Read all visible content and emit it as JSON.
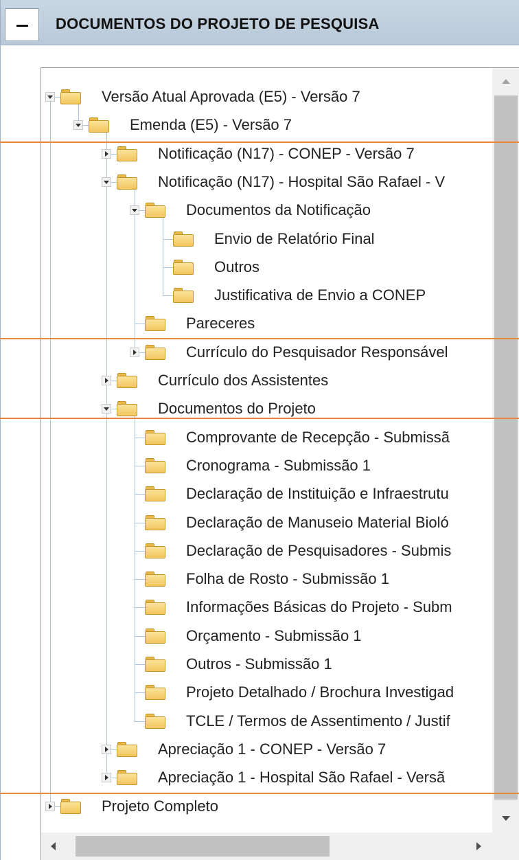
{
  "panel": {
    "title": "DOCUMENTOS DO PROJETO DE PESQUISA",
    "collapse_glyph": "−"
  },
  "tree": [
    {
      "label": "Versão Atual Aprovada (E5) - Versão 7",
      "level": 0,
      "expander": "expanded"
    },
    {
      "label": "Emenda (E5) - Versão 7",
      "level": 1,
      "expander": "expanded"
    },
    {
      "label": "Notificação (N17) - CONEP - Versão 7",
      "level": 2,
      "expander": "collapsed"
    },
    {
      "label": "Notificação (N17) - Hospital São Rafael - V",
      "level": 2,
      "expander": "expanded"
    },
    {
      "label": "Documentos da Notificação",
      "level": 3,
      "expander": "expanded"
    },
    {
      "label": "Envio de Relatório Final",
      "level": 4,
      "expander": "none"
    },
    {
      "label": "Outros",
      "level": 4,
      "expander": "none"
    },
    {
      "label": "Justificativa de Envio a CONEP",
      "level": 4,
      "expander": "none"
    },
    {
      "label": "Pareceres",
      "level": 3,
      "expander": "none"
    },
    {
      "label": "Currículo do Pesquisador Responsável",
      "level": 3,
      "expander": "collapsed"
    },
    {
      "label": "Currículo dos Assistentes",
      "level": 2,
      "expander": "collapsed"
    },
    {
      "label": "Documentos do Projeto",
      "level": 2,
      "expander": "expanded"
    },
    {
      "label": "Comprovante de Recepção - Submissã",
      "level": 3,
      "expander": "none"
    },
    {
      "label": "Cronograma - Submissão 1",
      "level": 3,
      "expander": "none"
    },
    {
      "label": "Declaração de Instituição e Infraestrutu",
      "level": 3,
      "expander": "none"
    },
    {
      "label": "Declaração de Manuseio Material Bioló",
      "level": 3,
      "expander": "none"
    },
    {
      "label": "Declaração de Pesquisadores - Submis",
      "level": 3,
      "expander": "none"
    },
    {
      "label": "Folha de Rosto - Submissão 1",
      "level": 3,
      "expander": "none"
    },
    {
      "label": "Informações Básicas do Projeto - Subm",
      "level": 3,
      "expander": "none"
    },
    {
      "label": "Orçamento - Submissão 1",
      "level": 3,
      "expander": "none"
    },
    {
      "label": "Outros - Submissão 1",
      "level": 3,
      "expander": "none"
    },
    {
      "label": "Projeto Detalhado / Brochura Investigad",
      "level": 3,
      "expander": "none"
    },
    {
      "label": "TCLE / Termos de Assentimento / Justif",
      "level": 3,
      "expander": "none"
    },
    {
      "label": "Apreciação 1 - CONEP - Versão 7",
      "level": 2,
      "expander": "collapsed"
    },
    {
      "label": "Apreciação 1 - Hospital São Rafael - Versã",
      "level": 2,
      "expander": "collapsed"
    },
    {
      "label": "Projeto Completo",
      "level": 0,
      "expander": "collapsed"
    }
  ],
  "colors": {
    "header_bg": "#c2d1e0",
    "folder": "#f3c65e",
    "tree_line": "#a8c4e0",
    "overlay_line": "#e8853a"
  }
}
